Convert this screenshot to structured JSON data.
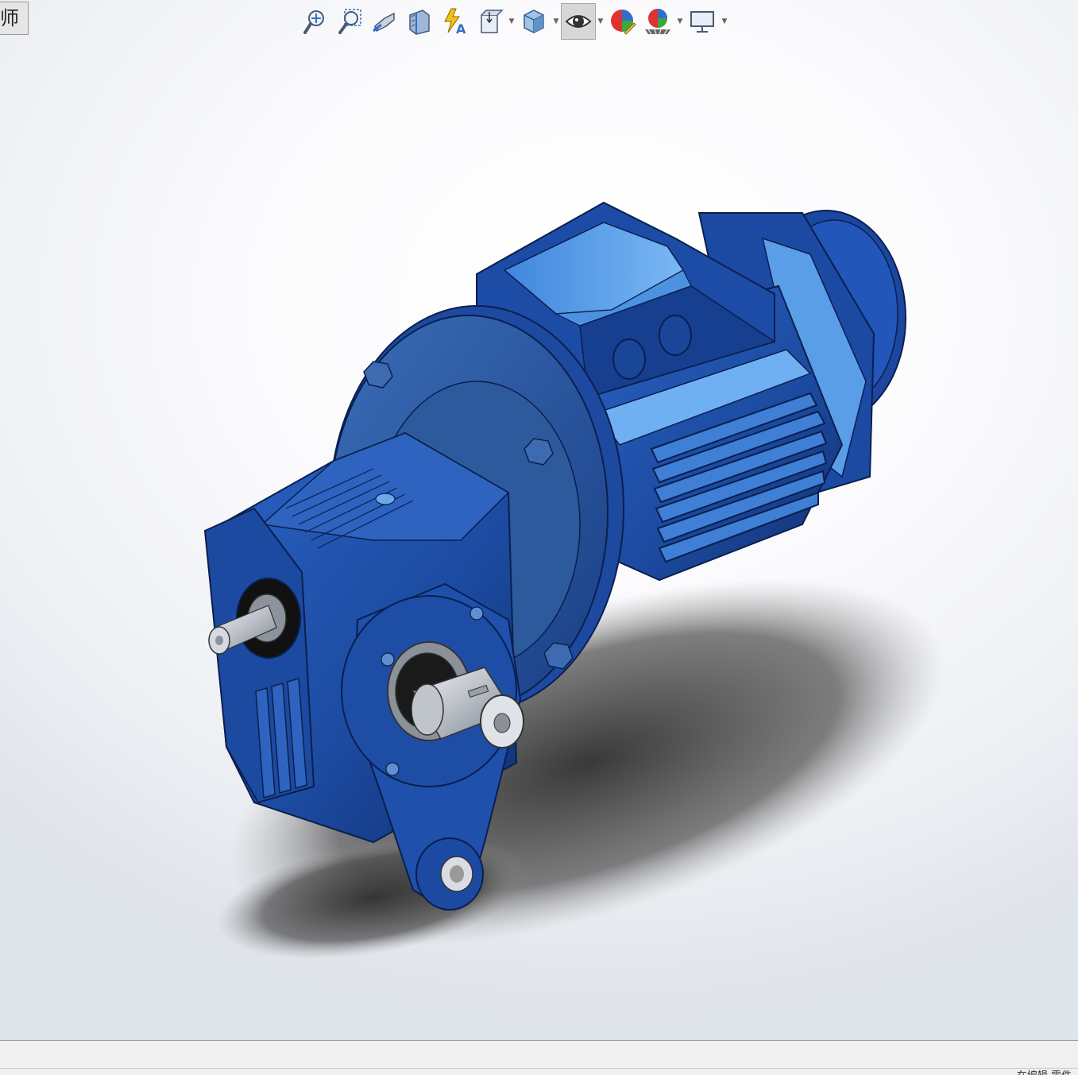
{
  "tab": {
    "label": "师"
  },
  "toolbar": {
    "buttons": [
      {
        "icon": "zoom-to-fit-icon",
        "dropdown": false,
        "active": false
      },
      {
        "icon": "zoom-to-area-icon",
        "dropdown": false,
        "active": false
      },
      {
        "icon": "previous-view-icon",
        "dropdown": false,
        "active": false
      },
      {
        "icon": "section-view-icon",
        "dropdown": false,
        "active": false
      },
      {
        "icon": "dynamic-annotation-views-icon",
        "dropdown": false,
        "active": false
      },
      {
        "icon": "view-orientation-icon",
        "dropdown": true,
        "active": false
      },
      {
        "icon": "display-style-icon",
        "dropdown": true,
        "active": false
      },
      {
        "icon": "hide-show-items-icon",
        "dropdown": true,
        "active": true
      },
      {
        "icon": "edit-appearance-icon",
        "dropdown": false,
        "active": false
      },
      {
        "icon": "apply-scene-icon",
        "dropdown": true,
        "active": false
      },
      {
        "icon": "view-settings-icon",
        "dropdown": true,
        "active": false
      }
    ]
  },
  "colors": {
    "model_blue": "#1f4fa8",
    "model_blue_light": "#6aa8ea",
    "model_blue_dark": "#0f2e6e",
    "shaft_steel": "#c9cdd3",
    "shadow": "#3a3a3a"
  },
  "status": {
    "text": "在编辑 零件"
  }
}
